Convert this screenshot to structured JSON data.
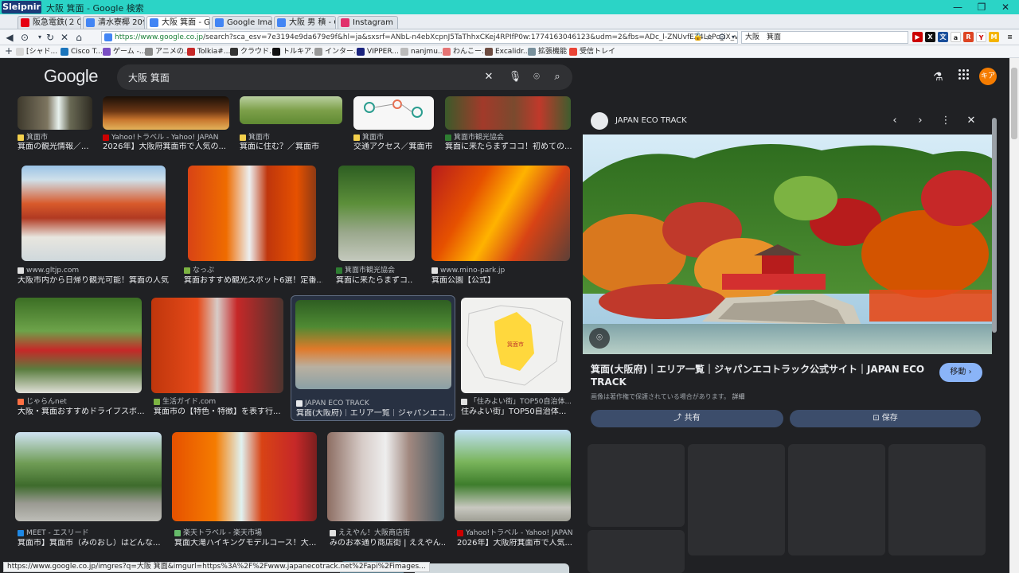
{
  "window": {
    "app_name": "Sleipnir",
    "title": "大阪 箕面 - Google 検索",
    "minimize": "—",
    "restore": "❐",
    "close": "✕"
  },
  "tabs": [
    {
      "label": "阪急電鉄(２０...",
      "color": "#e60012"
    },
    {
      "label": "清水寮椰 20代 ...",
      "color": "#4285f4"
    },
    {
      "label": "大阪 箕面 - Goo...",
      "color": "#4285f4"
    },
    {
      "label": "Google Image R...",
      "color": "#4285f4"
    },
    {
      "label": "大阪 男 積 - Go...",
      "color": "#4285f4"
    },
    {
      "label": "Instagram",
      "color": "#e1306c"
    }
  ],
  "tab_add": "+",
  "tab_menu": "▾",
  "nav": {
    "url_prefix": "https://www.google.co.jp",
    "url_rest": "/search?sca_esv=7e3194e9da679e9f&hl=ja&sxsrf=ANbL-n4ebXcpnJ5TaThhxCKej4RPIfP0w:1774163046123&udm=2&fbs=ADc_l-ZNUvfEZ4LePc_iX_vnq-YQjKEndmMG71j-UK_Xmt2o2L",
    "search_box": "大阪　箕面"
  },
  "bookmarks": [
    "[シャド...",
    "Cisco T...",
    "ゲーム -...",
    "アニメの...",
    "Tolkia#...",
    "クラウド...",
    "トルキア...",
    "インター...",
    "VIPPER...",
    "nanjmu...",
    "わんこー...",
    "Excalidr...",
    "拡張機能",
    "受信トレイ"
  ],
  "google": {
    "logo": "Google",
    "query": "大阪 箕面",
    "avatar_text": "キア"
  },
  "results": [
    {
      "src": "箕面市",
      "title": "箕面の観光情報／..."
    },
    {
      "src": "Yahoo!トラベル - Yahoo! JAPAN",
      "title": "2026年】大阪府箕面市で人気の..."
    },
    {
      "src": "箕面市",
      "title": "箕面に住む？／箕面市"
    },
    {
      "src": "箕面市",
      "title": "交通アクセス／箕面市"
    },
    {
      "src": "箕面市観光協会",
      "title": "箕面に来たらまずココ！初めての..."
    },
    {
      "src": "www.gltjp.com",
      "title": "大阪市内から日帰り観光可能！箕面の人気..."
    },
    {
      "src": "なっぷ",
      "title": "箕面おすすめ観光スポット6選！定番..."
    },
    {
      "src": "箕面市観光協会",
      "title": "箕面に来たらまずコ..."
    },
    {
      "src": "www.mino-park.jp",
      "title": "箕面公園【公式】"
    },
    {
      "src": "じゃらんnet",
      "title": "大阪・箕面おすすめドライブスポ..."
    },
    {
      "src": "生活ガイド.com",
      "title": "箕面市の【特色・特徴】を表す行..."
    },
    {
      "src": "JAPAN ECO TRACK",
      "title": "箕面(大阪府)｜エリア一覧｜ジャパンエコ..."
    },
    {
      "src": "「住みよい街」TOP50自治体...",
      "title": "住みよい街」TOP50自治体..."
    },
    {
      "src": "MEET - エスリード",
      "title": "箕面市】箕面市（みのおし）はどんな..."
    },
    {
      "src": "楽天トラベル - 楽天市場",
      "title": "箕面大滝ハイキングモデルコース！大..."
    },
    {
      "src": "ええやん！大阪商店街",
      "title": "みのお本通り商店街 | ええやん..."
    },
    {
      "src": "Yahoo!トラベル - Yahoo! JAPAN",
      "title": "2026年】大阪府箕面市で人気..."
    }
  ],
  "map_label": "箕面市",
  "panel": {
    "site": "JAPAN ECO TRACK",
    "title": "箕面(大阪府)｜エリア一覧｜ジャパンエコトラック公式サイト｜JAPAN ECO TRACK",
    "visit": "移動 ›",
    "copyright": "画像は著作権で保護されている場合があります。",
    "detail": "詳細",
    "share": "共有",
    "save": "保存"
  },
  "status_url": "https://www.google.co.jp/imgres?q=大阪 箕面&imgurl=https%3A%2F%2Fwww.japanecotrack.net%2Fapi%2Fimages..."
}
